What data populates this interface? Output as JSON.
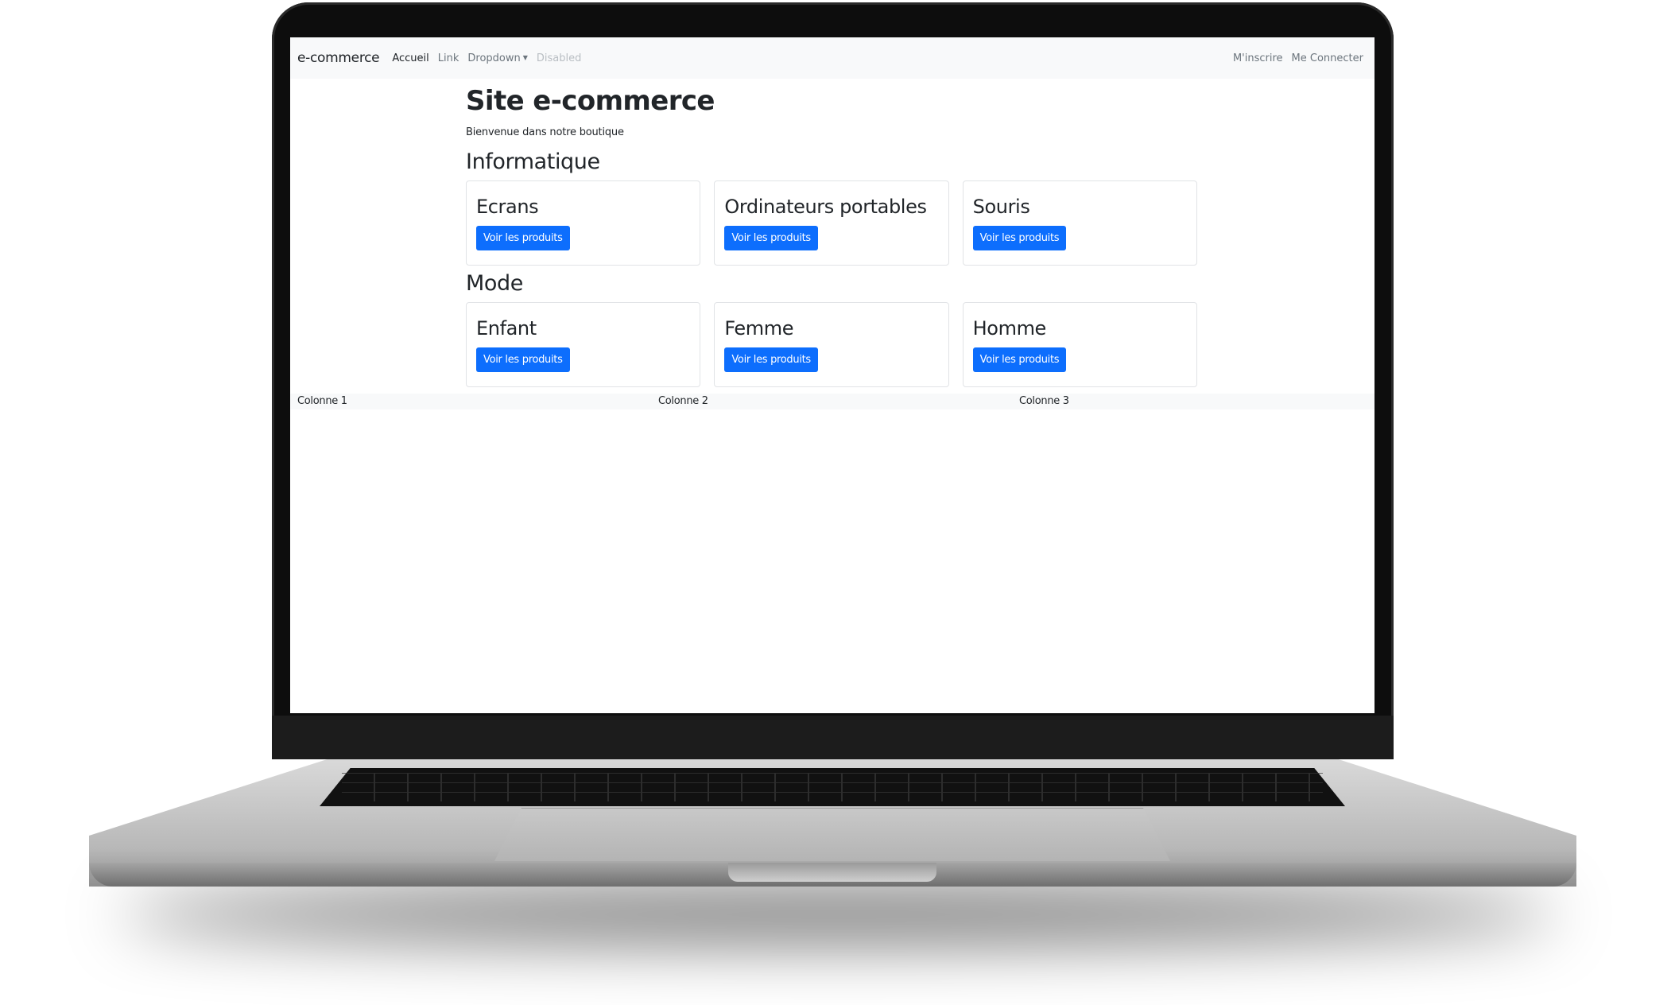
{
  "navbar": {
    "brand": "e-commerce",
    "items": [
      {
        "label": "Accueil"
      },
      {
        "label": "Link"
      },
      {
        "label": "Dropdown"
      },
      {
        "label": "Disabled"
      }
    ],
    "right_items": [
      {
        "label": "M'inscrire"
      },
      {
        "label": "Me Connecter"
      }
    ]
  },
  "main": {
    "title": "Site e-commerce",
    "subtitle": "Bienvenue dans notre boutique",
    "sections": [
      {
        "title": "Informatique",
        "cards": [
          {
            "title": "Ecrans",
            "button": "Voir les produits"
          },
          {
            "title": "Ordinateurs portables",
            "button": "Voir les produits"
          },
          {
            "title": "Souris",
            "button": "Voir les produits"
          }
        ]
      },
      {
        "title": "Mode",
        "cards": [
          {
            "title": "Enfant",
            "button": "Voir les produits"
          },
          {
            "title": "Femme",
            "button": "Voir les produits"
          },
          {
            "title": "Homme",
            "button": "Voir les produits"
          }
        ]
      }
    ]
  },
  "footer": {
    "columns": [
      "Colonne 1",
      "Colonne 2",
      "Colonne 3"
    ]
  },
  "colors": {
    "primary": "#0d6efd",
    "navbar_bg": "#f8f9fa",
    "text": "#212529"
  }
}
